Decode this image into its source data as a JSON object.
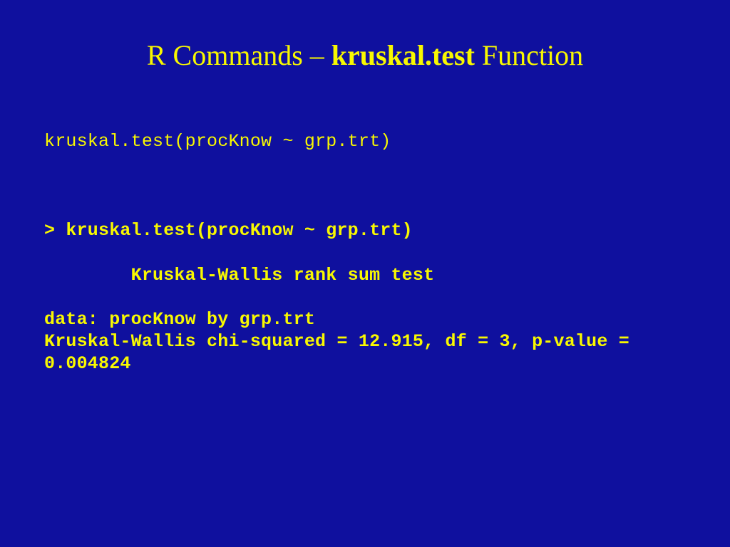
{
  "title": {
    "prefix": "R Commands – ",
    "bold": "kruskal.test",
    "suffix": " Function"
  },
  "code": {
    "line1": "kruskal.test(procKnow ~ grp.trt)",
    "line2": "> kruskal.test(procKnow ~ grp.trt)",
    "line3": "        Kruskal-Wallis rank sum test",
    "line4": "data:  procKnow by grp.trt",
    "line5": "Kruskal-Wallis chi-squared = 12.915, df = 3, p-value =",
    "line6": "0.004824"
  }
}
